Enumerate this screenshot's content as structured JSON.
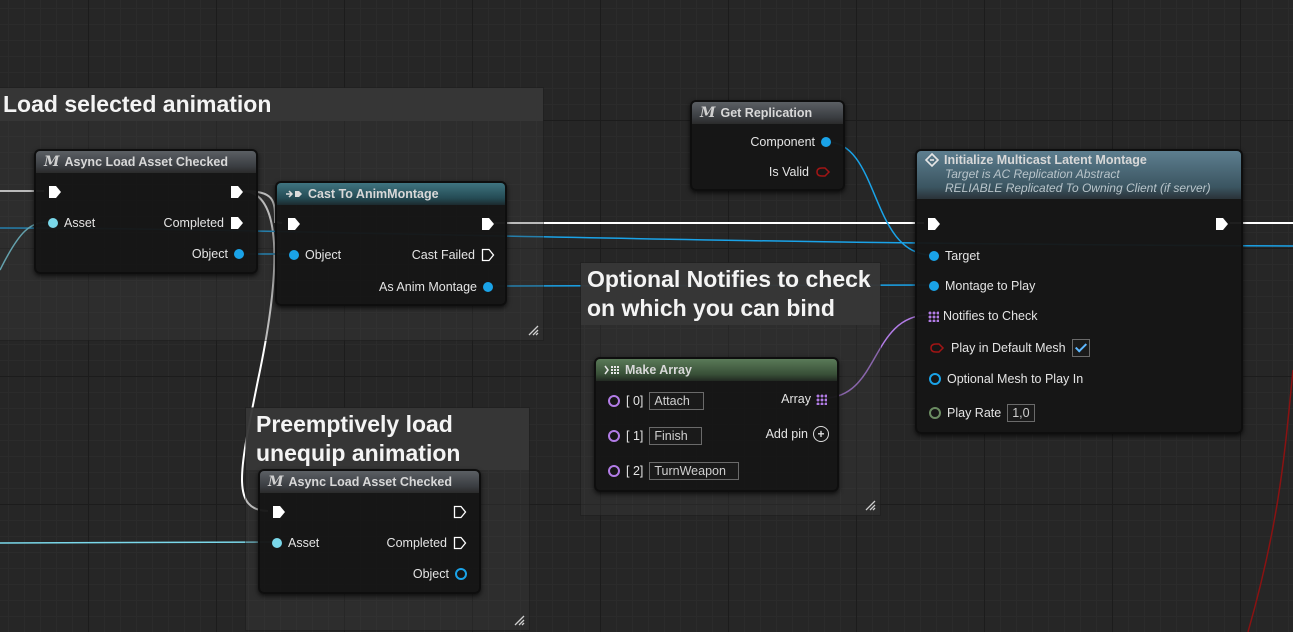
{
  "comments": {
    "load_selected": "Load selected animation",
    "optional_notifies": "Optional Notifies to check on which you can bind",
    "preemptive": "Preemptively load unequip animation"
  },
  "nodes": {
    "async_load_1": {
      "title": "Async Load Asset Checked",
      "asset": "Asset",
      "completed": "Completed",
      "object": "Object"
    },
    "cast": {
      "title": "Cast To AnimMontage",
      "object": "Object",
      "cast_failed": "Cast Failed",
      "as_anim_montage": "As Anim Montage"
    },
    "get_replication": {
      "title": "Get Replication",
      "component": "Component",
      "is_valid": "Is Valid"
    },
    "init_multicast": {
      "title": "Initialize Multicast Latent Montage",
      "subtitle1": "Target is AC Replication Abstract",
      "subtitle2": "RELIABLE Replicated To Owning Client (if server)",
      "target": "Target",
      "montage": "Montage to Play",
      "notifies": "Notifies to Check",
      "play_default": "Play in Default Mesh",
      "play_default_checked": true,
      "optional_mesh": "Optional Mesh to Play In",
      "play_rate": "Play Rate",
      "play_rate_value": "1,0"
    },
    "make_array": {
      "title": "Make Array",
      "items": [
        {
          "index": "[ 0]",
          "value": "Attach"
        },
        {
          "index": "[ 1]",
          "value": "Finish"
        },
        {
          "index": "[ 2]",
          "value": "TurnWeapon"
        }
      ],
      "array": "Array",
      "add_pin": "Add pin"
    },
    "async_load_2": {
      "title": "Async Load Asset Checked",
      "asset": "Asset",
      "completed": "Completed",
      "object": "Object"
    }
  },
  "colors": {
    "exec_wire": "#ffffff",
    "object_wire": "#1aa3e8",
    "array_wire": "#b27ce6",
    "red_wire": "#8a1212",
    "asset_wire": "#7ad8ea"
  },
  "icons": {
    "macro": "macro-icon",
    "cast": "cast-icon",
    "function": "function-icon",
    "make_array": "array-grid-icon"
  }
}
